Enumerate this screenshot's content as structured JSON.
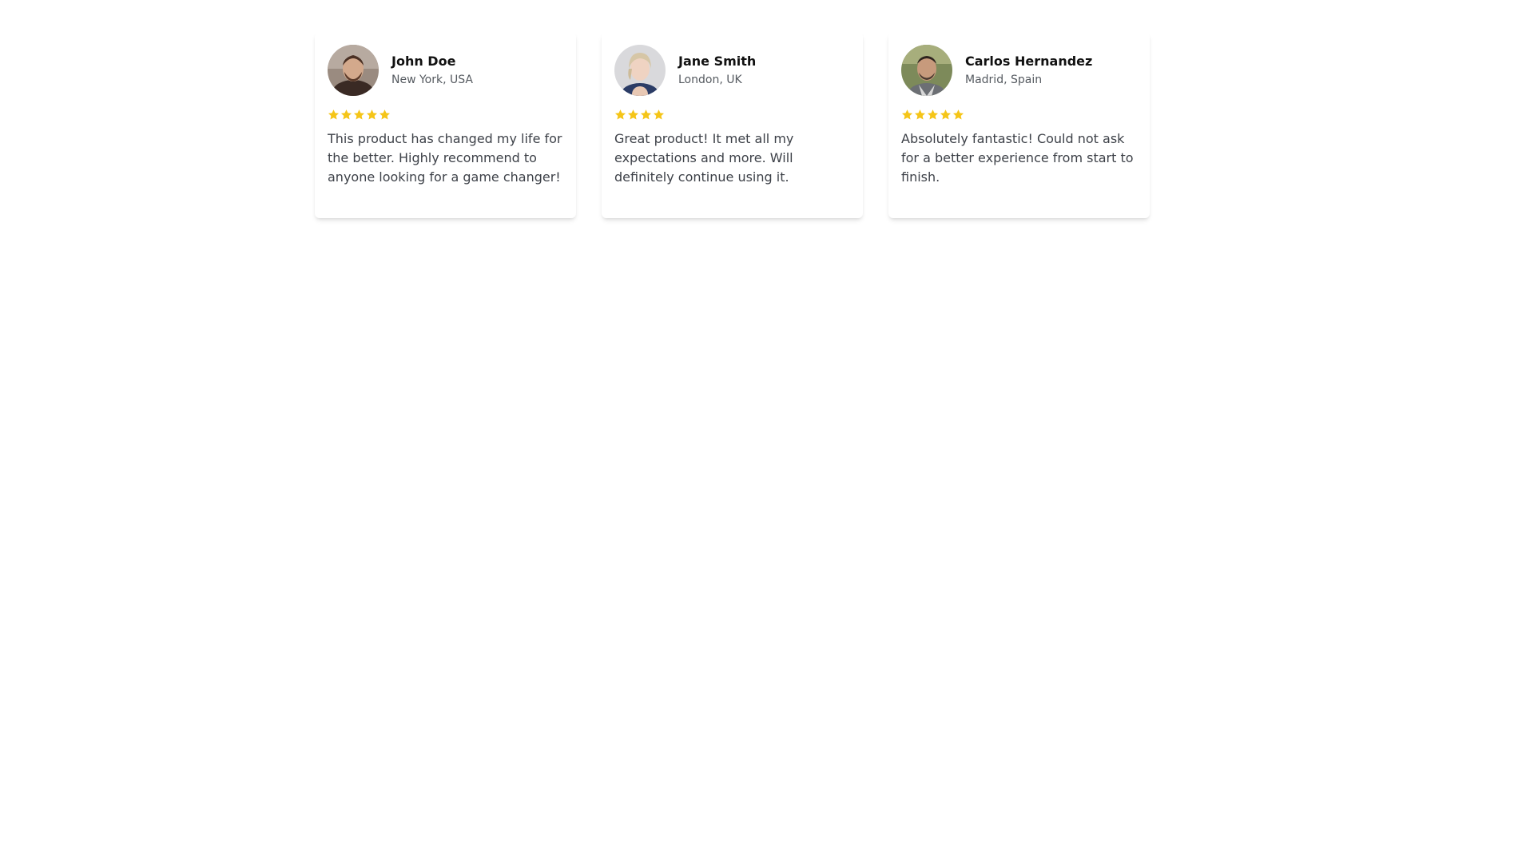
{
  "reviews": [
    {
      "name": "John Doe",
      "location": "New York, USA",
      "rating": 5,
      "text": "This product has changed my life for the better. Highly recommend to anyone looking for a game changer!"
    },
    {
      "name": "Jane Smith",
      "location": "London, UK",
      "rating": 4,
      "text": "Great product! It met all my expectations and more. Will definitely continue using it."
    },
    {
      "name": "Carlos Hernandez",
      "location": "Madrid, Spain",
      "rating": 5,
      "text": "Absolutely fantastic! Could not ask for a better experience from start to finish."
    }
  ],
  "colors": {
    "star": "#f5c518",
    "name": "#111111",
    "location": "#555a60",
    "text": "#3d4148"
  },
  "icons": {
    "star": "star-icon",
    "avatar": "avatar-photo"
  }
}
